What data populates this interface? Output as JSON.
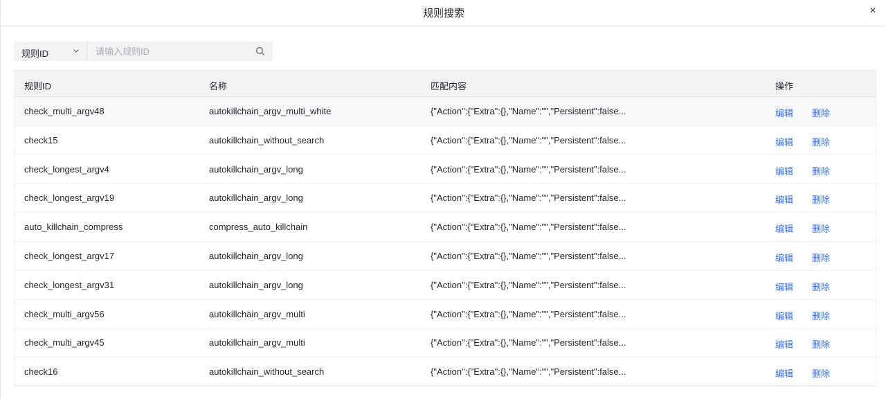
{
  "modal": {
    "title": "规则搜索",
    "close": "×"
  },
  "search": {
    "field": "规则ID",
    "placeholder": "请输入规则ID"
  },
  "table": {
    "headers": [
      "规则ID",
      "名称",
      "匹配内容",
      "操作"
    ],
    "edit_label": "编辑",
    "delete_label": "删除",
    "rows": [
      {
        "id": "check_multi_argv48",
        "name": "autokillchain_argv_multi_white",
        "content": "{\"Action\":{\"Extra\":{},\"Name\":\"\",\"Persistent\":false..."
      },
      {
        "id": "check15",
        "name": "autokillchain_without_search",
        "content": "{\"Action\":{\"Extra\":{},\"Name\":\"\",\"Persistent\":false..."
      },
      {
        "id": "check_longest_argv4",
        "name": "autokillchain_argv_long",
        "content": "{\"Action\":{\"Extra\":{},\"Name\":\"\",\"Persistent\":false..."
      },
      {
        "id": "check_longest_argv19",
        "name": "autokillchain_argv_long",
        "content": "{\"Action\":{\"Extra\":{},\"Name\":\"\",\"Persistent\":false..."
      },
      {
        "id": "auto_killchain_compress",
        "name": "compress_auto_killchain",
        "content": "{\"Action\":{\"Extra\":{},\"Name\":\"\",\"Persistent\":false..."
      },
      {
        "id": "check_longest_argv17",
        "name": "autokillchain_argv_long",
        "content": "{\"Action\":{\"Extra\":{},\"Name\":\"\",\"Persistent\":false..."
      },
      {
        "id": "check_longest_argv31",
        "name": "autokillchain_argv_long",
        "content": "{\"Action\":{\"Extra\":{},\"Name\":\"\",\"Persistent\":false..."
      },
      {
        "id": "check_multi_argv56",
        "name": "autokillchain_argv_multi",
        "content": "{\"Action\":{\"Extra\":{},\"Name\":\"\",\"Persistent\":false..."
      },
      {
        "id": "check_multi_argv45",
        "name": "autokillchain_argv_multi",
        "content": "{\"Action\":{\"Extra\":{},\"Name\":\"\",\"Persistent\":false..."
      },
      {
        "id": "check16",
        "name": "autokillchain_without_search",
        "content": "{\"Action\":{\"Extra\":{},\"Name\":\"\",\"Persistent\":false..."
      }
    ]
  },
  "colors": {
    "link": "#3370ff",
    "header_bg": "#f2f3f5",
    "border": "#eceef1"
  }
}
